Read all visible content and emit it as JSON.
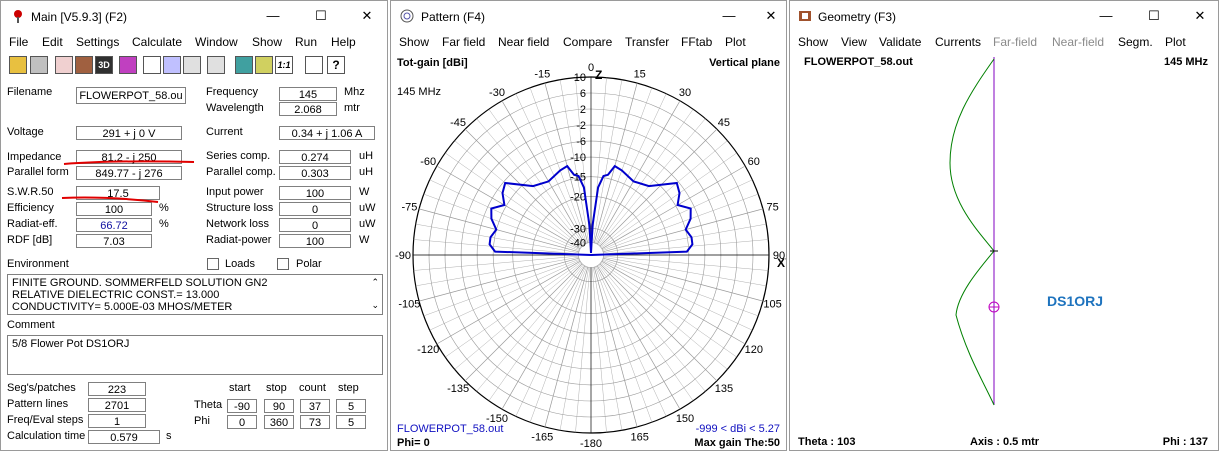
{
  "main": {
    "title": "Main [V5.9.3]  (F2)",
    "menu": [
      "File",
      "Edit",
      "Settings",
      "Calculate",
      "Window",
      "Show",
      "Run",
      "Help"
    ],
    "filename_label": "Filename",
    "filename": "FLOWERPOT_58.ou",
    "frequency_label": "Frequency",
    "frequency": "145",
    "frequency_unit": "Mhz",
    "wavelength_label": "Wavelength",
    "wavelength": "2.068",
    "wavelength_unit": "mtr",
    "voltage_label": "Voltage",
    "voltage": "291 + j 0 V",
    "current_label": "Current",
    "current": "0.34 + j 1.06 A",
    "impedance_label": "Impedance",
    "impedance": "81.2 - j 250",
    "series_label": "Series comp.",
    "series": "0.274",
    "series_unit": "uH",
    "parallel_form_label": "Parallel form",
    "parallel_form": "849.77 - j 276",
    "parallel_comp_label": "Parallel comp.",
    "parallel_comp": "0.303",
    "parallel_unit": "uH",
    "swr_label": "S.W.R.50",
    "swr": "17.5",
    "input_power_label": "Input power",
    "input_power": "100",
    "input_power_unit": "W",
    "efficiency_label": "Efficiency",
    "efficiency": "100",
    "pct1": "%",
    "structure_loss_label": "Structure loss",
    "structure_loss": "0",
    "structure_loss_unit": "uW",
    "radiat_eff_label": "Radiat-eff.",
    "radiat_eff": "66.72",
    "pct2": "%",
    "network_loss_label": "Network loss",
    "network_loss": "0",
    "network_loss_unit": "uW",
    "rdf_label": "RDF [dB]",
    "rdf": "7.03",
    "radiat_power_label": "Radiat-power",
    "radiat_power": "100",
    "radiat_power_unit": "W",
    "environment_label": "Environment",
    "loads_label": "Loads",
    "polar_label": "Polar",
    "environment_lines": [
      "FINITE GROUND.  SOMMERFELD SOLUTION GN2",
      "RELATIVE DIELECTRIC CONST.= 13.000",
      "CONDUCTIVITY= 5.000E-03 MHOS/METER"
    ],
    "comment_label": "Comment",
    "comment": "5/8 Flower Pot DS1ORJ",
    "segs_label": "Seg's/patches",
    "segs": "223",
    "pattern_lines_label": "Pattern lines",
    "pattern_lines": "2701",
    "freq_eval_label": "Freq/Eval steps",
    "freq_eval": "1",
    "calc_time_label": "Calculation time",
    "calc_time": "0.579",
    "calc_time_unit": "s",
    "grid_headers": [
      "start",
      "stop",
      "count",
      "step"
    ],
    "theta_label": "Theta",
    "theta": [
      "-90",
      "90",
      "37",
      "5"
    ],
    "phi_label": "Phi",
    "phi": [
      "0",
      "360",
      "73",
      "5"
    ],
    "accent_red": "#e00000"
  },
  "pattern": {
    "title": "Pattern   (F4)",
    "menu": [
      "Show",
      "Far field",
      "Near field",
      "Compare",
      "Transfer",
      "FFtab",
      "Plot"
    ],
    "tot_gain": "Tot-gain [dBi]",
    "plane": "Vertical plane",
    "freq": "145 MHz",
    "file": "FLOWERPOT_58.out",
    "range": "-999 < dBi < 5.27",
    "phi": "Phi= 0",
    "max_gain": "Max gain The:50",
    "z_label": "Z",
    "xy_label": "XY",
    "angle_labels": [
      "0",
      "15",
      "30",
      "45",
      "60",
      "75",
      "90",
      "105",
      "120",
      "135",
      "150",
      "165",
      "-180",
      "-165",
      "-150",
      "-135",
      "-120",
      "-105",
      "-90",
      "-75",
      "-60",
      "-45",
      "-30",
      "-15"
    ],
    "db_labels": [
      "10",
      "6",
      "2",
      "-2",
      "-6",
      "-10",
      "-15",
      "-20",
      "-30",
      "-40"
    ],
    "pattern_color": "#0000cc"
  },
  "geometry": {
    "title": "Geometry   (F3)",
    "menu": [
      "Show",
      "View",
      "Validate",
      "Currents",
      "Far-field",
      "Near-field",
      "Segm.",
      "Plot"
    ],
    "menu_disabled": [
      false,
      false,
      false,
      false,
      true,
      true,
      false,
      false
    ],
    "file": "FLOWERPOT_58.out",
    "freq": "145 MHz",
    "callsign": "DS1ORJ",
    "theta": "Theta : 103",
    "axis": "Axis : 0.5 mtr",
    "phi": "Phi : 137",
    "wire_color": "#8000c0",
    "current_color": "#008000",
    "callsign_color": "#1e73be"
  }
}
